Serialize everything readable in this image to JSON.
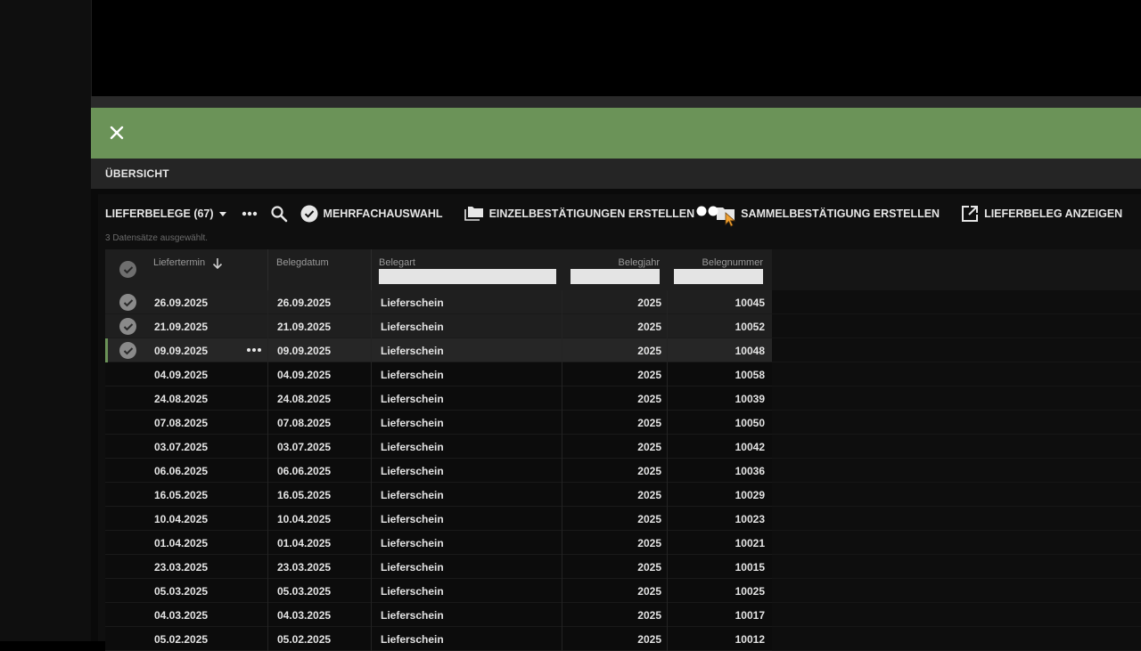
{
  "header": {
    "close_icon": "close-icon",
    "tab_title": "ÜBERSICHT",
    "accent_color": "#6b9358"
  },
  "toolbar": {
    "list_label": "LIEFERBELEGE (67)",
    "more_icon": "more-icon",
    "search_icon": "search-icon",
    "multiselect_label": "MEHRFACHAUSWAHL",
    "single_confirm_label": "EINZELBESTÄTIGUNGEN ERSTELLEN",
    "collective_confirm_label": "SAMMELBESTÄTIGUNG ERSTELLEN",
    "show_delivery_label": "LIEFERBELEG ANZEIGEN"
  },
  "selection_info": "3 Datensätze ausgewählt.",
  "columns": {
    "liefertermin": "Liefertermin",
    "belegdatum": "Belegdatum",
    "belegart": "Belegart",
    "belegjahr": "Belegjahr",
    "belegnummer": "Belegnummer"
  },
  "rows": [
    {
      "liefertermin": "26.09.2025",
      "belegdatum": "26.09.2025",
      "belegart": "Lieferschein",
      "belegjahr": "2025",
      "belegnummer": "10045",
      "selected": true
    },
    {
      "liefertermin": "21.09.2025",
      "belegdatum": "21.09.2025",
      "belegart": "Lieferschein",
      "belegjahr": "2025",
      "belegnummer": "10052",
      "selected": true
    },
    {
      "liefertermin": "09.09.2025",
      "belegdatum": "09.09.2025",
      "belegart": "Lieferschein",
      "belegjahr": "2025",
      "belegnummer": "10048",
      "selected": true,
      "focus": true
    },
    {
      "liefertermin": "04.09.2025",
      "belegdatum": "04.09.2025",
      "belegart": "Lieferschein",
      "belegjahr": "2025",
      "belegnummer": "10058"
    },
    {
      "liefertermin": "24.08.2025",
      "belegdatum": "24.08.2025",
      "belegart": "Lieferschein",
      "belegjahr": "2025",
      "belegnummer": "10039"
    },
    {
      "liefertermin": "07.08.2025",
      "belegdatum": "07.08.2025",
      "belegart": "Lieferschein",
      "belegjahr": "2025",
      "belegnummer": "10050"
    },
    {
      "liefertermin": "03.07.2025",
      "belegdatum": "03.07.2025",
      "belegart": "Lieferschein",
      "belegjahr": "2025",
      "belegnummer": "10042"
    },
    {
      "liefertermin": "06.06.2025",
      "belegdatum": "06.06.2025",
      "belegart": "Lieferschein",
      "belegjahr": "2025",
      "belegnummer": "10036"
    },
    {
      "liefertermin": "16.05.2025",
      "belegdatum": "16.05.2025",
      "belegart": "Lieferschein",
      "belegjahr": "2025",
      "belegnummer": "10029"
    },
    {
      "liefertermin": "10.04.2025",
      "belegdatum": "10.04.2025",
      "belegart": "Lieferschein",
      "belegjahr": "2025",
      "belegnummer": "10023"
    },
    {
      "liefertermin": "01.04.2025",
      "belegdatum": "01.04.2025",
      "belegart": "Lieferschein",
      "belegjahr": "2025",
      "belegnummer": "10021"
    },
    {
      "liefertermin": "23.03.2025",
      "belegdatum": "23.03.2025",
      "belegart": "Lieferschein",
      "belegjahr": "2025",
      "belegnummer": "10015"
    },
    {
      "liefertermin": "05.03.2025",
      "belegdatum": "05.03.2025",
      "belegart": "Lieferschein",
      "belegjahr": "2025",
      "belegnummer": "10025"
    },
    {
      "liefertermin": "04.03.2025",
      "belegdatum": "04.03.2025",
      "belegart": "Lieferschein",
      "belegjahr": "2025",
      "belegnummer": "10017"
    },
    {
      "liefertermin": "05.02.2025",
      "belegdatum": "05.02.2025",
      "belegart": "Lieferschein",
      "belegjahr": "2025",
      "belegnummer": "10012"
    }
  ]
}
